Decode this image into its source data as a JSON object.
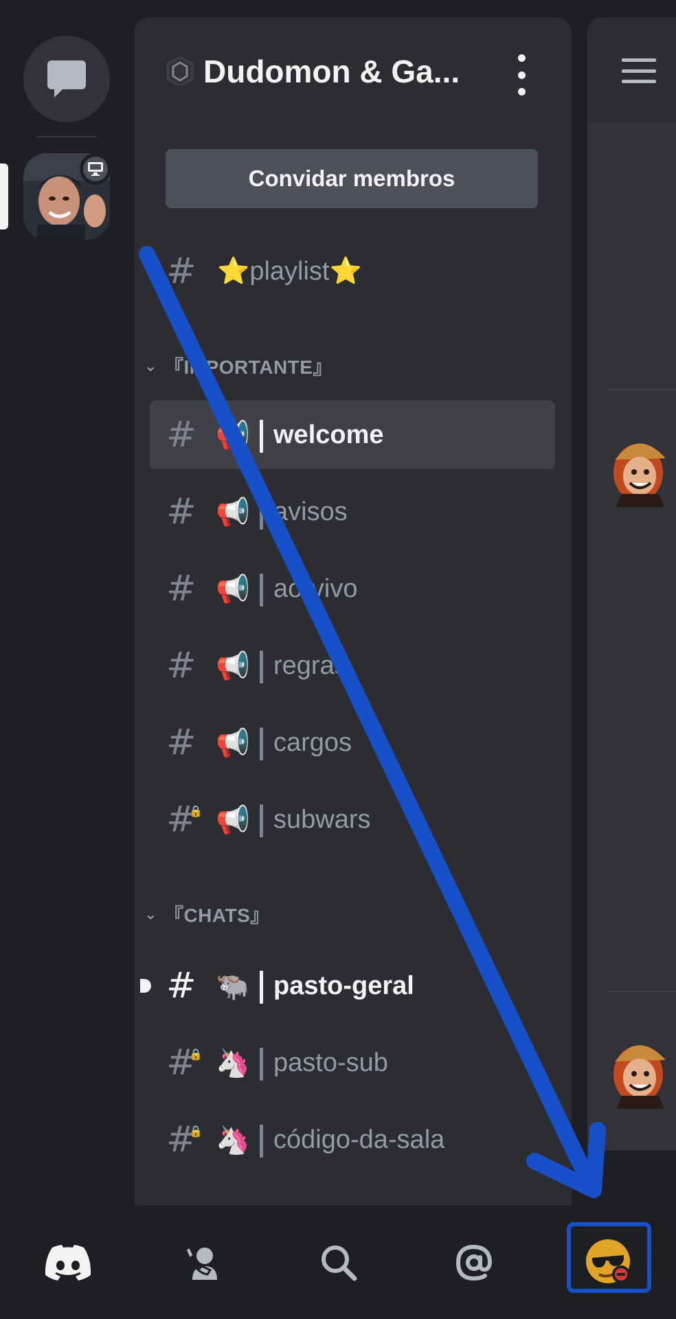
{
  "server_rail": {
    "dm_icon": "chat-bubble-icon",
    "server_badge_icon": "monitor-icon"
  },
  "guild": {
    "name": "Dudomon & Ga...",
    "invite_label": "Convidar membros"
  },
  "channels_top": [
    {
      "emoji": "⭐",
      "label": "⭐playlist⭐"
    }
  ],
  "categories": [
    {
      "name": "『IMPORTANTE』",
      "channels": [
        {
          "emoji": "📢",
          "label": "welcome",
          "locked": false,
          "selected": true
        },
        {
          "emoji": "📢",
          "label": "avisos",
          "locked": false
        },
        {
          "emoji": "📢",
          "label": "ao-vivo",
          "locked": false
        },
        {
          "emoji": "📢",
          "label": "regras",
          "locked": false
        },
        {
          "emoji": "📢",
          "label": "cargos",
          "locked": false
        },
        {
          "emoji": "📢",
          "label": "subwars",
          "locked": true
        }
      ]
    },
    {
      "name": "『CHATS』",
      "channels": [
        {
          "emoji": "🐃",
          "label": "pasto-geral",
          "locked": false,
          "unread": true
        },
        {
          "emoji": "🦄",
          "label": "pasto-sub",
          "locked": true
        },
        {
          "emoji": "🦄",
          "label": "código-da-sala",
          "locked": true
        }
      ]
    }
  ],
  "bottom_nav": {
    "items": [
      "discord-home-icon",
      "friends-icon",
      "search-icon",
      "mentions-icon",
      "profile-avatar"
    ]
  },
  "colors": {
    "background": "#1e1f22",
    "panel": "#2b2d31",
    "selected": "#3f4147",
    "annotation_blue": "#1750c9"
  }
}
